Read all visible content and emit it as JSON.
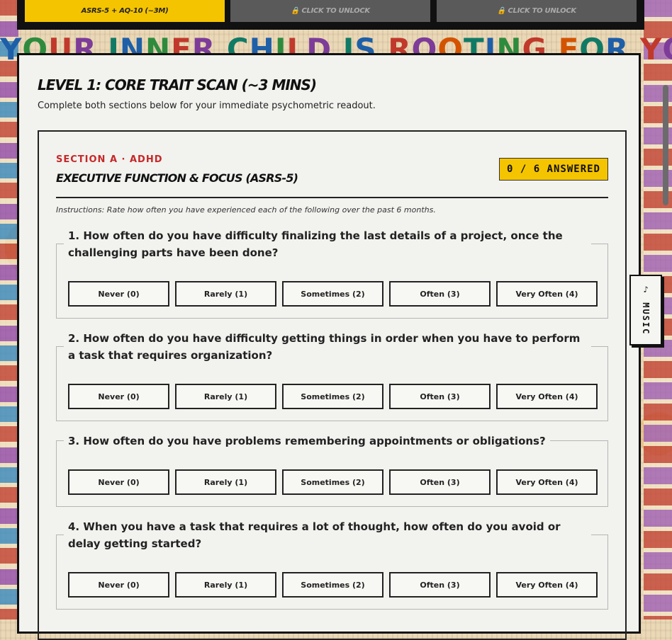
{
  "tabs": [
    {
      "label": "ASRS-5 + AQ-10 (~3M)",
      "active": true
    },
    {
      "label": "🔒 CLICK TO UNLOCK",
      "active": false
    },
    {
      "label": "🔒 CLICK TO UNLOCK",
      "active": false
    }
  ],
  "banner": {
    "letters": [
      "Y",
      "O",
      "U",
      "R",
      " ",
      "I",
      "N",
      "N",
      "E",
      "R",
      " ",
      "C",
      "H",
      "I",
      "L",
      "D",
      " ",
      "I",
      "S",
      " ",
      "R",
      "O",
      "O",
      "T",
      "I",
      "N",
      "G",
      " ",
      "F",
      "O",
      "R",
      " ",
      "Y",
      "O"
    ],
    "colors": [
      "#1e5fa8",
      "#2e8b3e",
      "#c0392b",
      "#7d3c98",
      "#d35400",
      "#117a65"
    ]
  },
  "level": {
    "title": "LEVEL 1: CORE TRAIT SCAN (~3 MINS)",
    "subtitle": "Complete both sections below for your immediate psychometric readout."
  },
  "section": {
    "kicker": "SECTION A · ADHD",
    "title": "EXECUTIVE FUNCTION & FOCUS (ASRS-5)",
    "progress": "0 / 6 ANSWERED",
    "instructions": "Instructions: Rate how often you have experienced each of the following over the past 6 months."
  },
  "options": [
    "Never (0)",
    "Rarely (1)",
    "Sometimes (2)",
    "Often (3)",
    "Very Often (4)"
  ],
  "questions": [
    {
      "text": "1. How often do you have difficulty finalizing the last details of a project, once the challenging parts have been done?"
    },
    {
      "text": "2. How often do you have difficulty getting things in order when you have to perform a task that requires organization?"
    },
    {
      "text": "3. How often do you have problems remembering appointments or obligations?"
    },
    {
      "text": "4. When you have a task that requires a lot of thought, how often do you avoid or delay getting started?"
    }
  ],
  "music": {
    "label": "♪ MUSIC"
  }
}
